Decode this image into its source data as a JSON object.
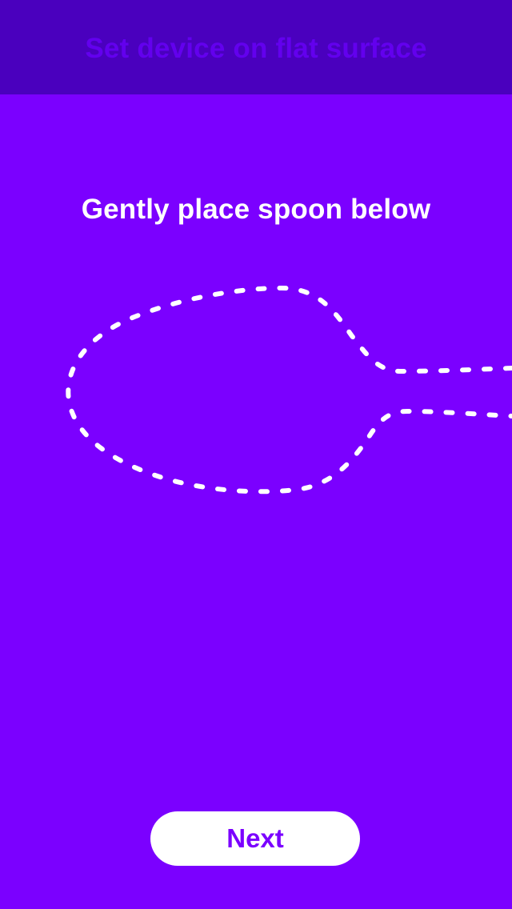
{
  "header": {
    "title": "Set device on flat surface"
  },
  "main": {
    "instruction": "Gently place spoon below"
  },
  "footer": {
    "next_label": "Next"
  },
  "colors": {
    "background": "#7B00FF",
    "header_background": "#4A00BE",
    "header_text": "#6300EE",
    "button_background": "#FFFFFF",
    "button_text": "#7B00FF",
    "outline": "#FFFFFF"
  }
}
